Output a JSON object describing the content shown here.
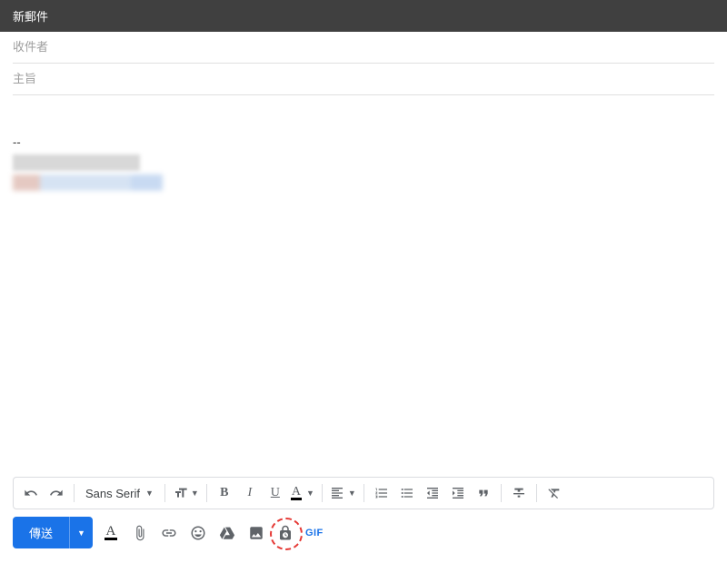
{
  "header": {
    "title": "新郵件"
  },
  "fields": {
    "to_placeholder": "收件者",
    "subject_placeholder": "主旨"
  },
  "body": {
    "signature_divider": "--"
  },
  "format_toolbar": {
    "font_family": "Sans Serif",
    "text_color_letter": "A"
  },
  "bottom": {
    "send_label": "傳送",
    "send_more_glyph": "▼",
    "format_A": "A",
    "gif_label": "GIF"
  }
}
